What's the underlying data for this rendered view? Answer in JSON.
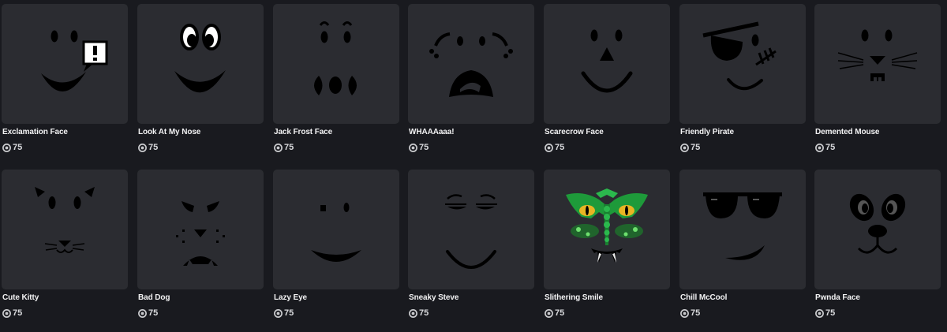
{
  "currency_icon": "robux-icon",
  "colors": {
    "background": "#191a1f",
    "tile": "#2b2c31",
    "text": "#f2f2f3"
  },
  "items": [
    {
      "name": "Exclamation Face",
      "price": "75"
    },
    {
      "name": "Look At My Nose",
      "price": "75"
    },
    {
      "name": "Jack Frost Face",
      "price": "75"
    },
    {
      "name": "WHAAAaaa!",
      "price": "75"
    },
    {
      "name": "Scarecrow Face",
      "price": "75"
    },
    {
      "name": "Friendly Pirate",
      "price": "75"
    },
    {
      "name": "Demented Mouse",
      "price": "75"
    },
    {
      "name": "Cute Kitty",
      "price": "75"
    },
    {
      "name": "Bad Dog",
      "price": "75"
    },
    {
      "name": "Lazy Eye",
      "price": "75"
    },
    {
      "name": "Sneaky Steve",
      "price": "75"
    },
    {
      "name": "Slithering Smile",
      "price": "75"
    },
    {
      "name": "Chill McCool",
      "price": "75"
    },
    {
      "name": "Pwnda Face",
      "price": "75"
    }
  ]
}
